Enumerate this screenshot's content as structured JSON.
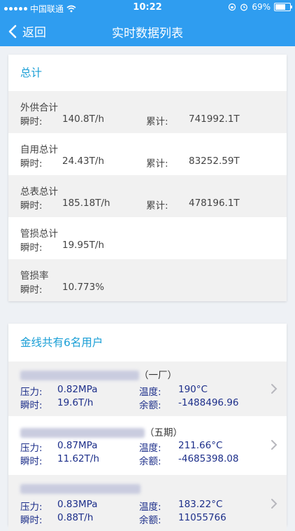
{
  "status_bar": {
    "carrier": "中国联通",
    "time": "10:22",
    "battery": "69%"
  },
  "nav": {
    "back_label": "返回",
    "title": "实时数据列表"
  },
  "summary": {
    "title": "总计",
    "rows": [
      {
        "name": "外供合计",
        "l1": "瞬时:",
        "v1": "140.8T/h",
        "l2": "累计:",
        "v2": "741992.1T"
      },
      {
        "name": "自用总计",
        "l1": "瞬时:",
        "v1": "24.43T/h",
        "l2": "累计:",
        "v2": "83252.59T"
      },
      {
        "name": "总表总计",
        "l1": "瞬时:",
        "v1": "185.18T/h",
        "l2": "累计:",
        "v2": "478196.1T"
      },
      {
        "name": "管损总计",
        "l1": "瞬时:",
        "v1": "19.95T/h"
      },
      {
        "name": "管损率",
        "l1": "瞬时:",
        "v1": "10.773%"
      }
    ]
  },
  "users": {
    "title": "金线共有6名用户",
    "items": [
      {
        "name_suffix": "（一厂）",
        "pressure_label": "压力:",
        "pressure": "0.82MPa",
        "temp_label": "温度:",
        "temp": "190°C",
        "flow_label": "瞬时:",
        "flow": "19.6T/h",
        "balance_label": "余额:",
        "balance": "-1488496.96"
      },
      {
        "name_suffix": "（五期）",
        "pressure_label": "压力:",
        "pressure": "0.87MPa",
        "temp_label": "温度:",
        "temp": "211.66°C",
        "flow_label": "瞬时:",
        "flow": "11.62T/h",
        "balance_label": "余额:",
        "balance": "-4685398.08"
      },
      {
        "name_suffix": "",
        "pressure_label": "压力:",
        "pressure": "0.83MPa",
        "temp_label": "温度:",
        "temp": "183.22°C",
        "flow_label": "瞬时:",
        "flow": "0.88T/h",
        "balance_label": "余额:",
        "balance": "11055766"
      }
    ]
  }
}
